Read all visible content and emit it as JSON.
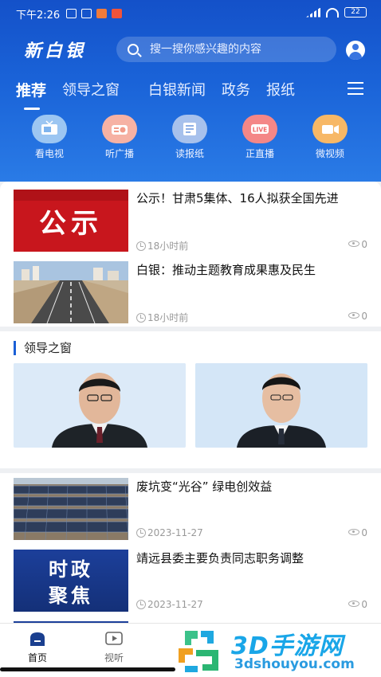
{
  "status_bar": {
    "time": "下午2:26",
    "battery": "22"
  },
  "header": {
    "logo": "新白银",
    "search_placeholder": "搜一搜你感兴趣的内容"
  },
  "tabs": [
    {
      "label": "推荐"
    },
    {
      "label": "领导之窗"
    },
    {
      "label": "白银新闻"
    },
    {
      "label": "政务"
    },
    {
      "label": "报纸"
    }
  ],
  "quick_links": [
    {
      "label": "看电视",
      "icon": "tv-icon",
      "color": "#7fb4ee"
    },
    {
      "label": "听广播",
      "icon": "radio-icon",
      "color": "#f29c8a"
    },
    {
      "label": "读报纸",
      "icon": "newspaper-icon",
      "color": "#8fb0e6"
    },
    {
      "label": "正直播",
      "icon": "live-icon",
      "color": "#f06a6a",
      "badge": "LIVE"
    },
    {
      "label": "微视频",
      "icon": "video-icon",
      "color": "#f5a54a"
    }
  ],
  "top_news": [
    {
      "title": "公示！甘肃5集体、16人拟获全国先进",
      "time": "18小时前",
      "views": "0",
      "thumb_text": "公示"
    },
    {
      "title": "白银：推动主题教育成果惠及民生",
      "time": "18小时前",
      "views": "0"
    }
  ],
  "leaders_section": {
    "title": "领导之窗"
  },
  "more_news": [
    {
      "title": "废坑变“光谷”  绿电创效益",
      "time": "2023-11-27",
      "views": "0"
    },
    {
      "title": "靖远县委主要负责同志职务调整",
      "time": "2023-11-27",
      "views": "0",
      "thumb_text_1": "时政",
      "thumb_text_2": "聚焦"
    }
  ],
  "bottom_nav": [
    {
      "label": "首页",
      "icon": "home-icon"
    },
    {
      "label": "视听",
      "icon": "play-icon"
    }
  ],
  "watermark": {
    "brand": "3D手游网",
    "url": "3dshouyou.com"
  },
  "colors": {
    "brand_blue": "#1a5fd6",
    "thumb_red": "#c8161d"
  }
}
